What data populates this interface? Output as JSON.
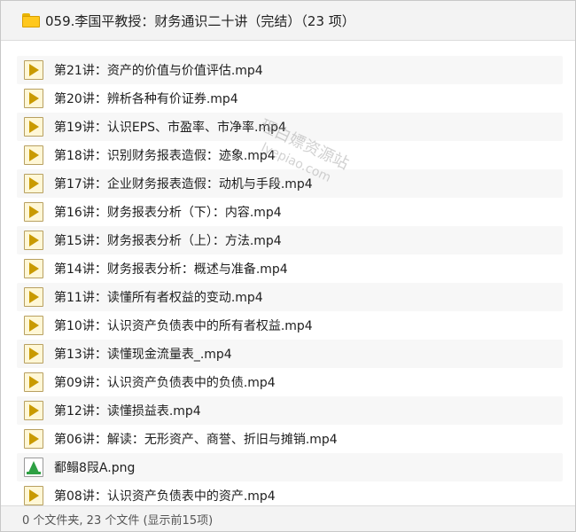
{
  "header": {
    "title": "059.李国平教授：财务通识二十讲（完结）（23 项）",
    "folder_icon": "folder-icon"
  },
  "files": [
    {
      "name": "第21讲：资产的价值与价值评估.mp4",
      "type": "mp4"
    },
    {
      "name": "第20讲：辨析各种有价证券.mp4",
      "type": "mp4"
    },
    {
      "name": "第19讲：认识EPS、市盈率、市净率.mp4",
      "type": "mp4"
    },
    {
      "name": "第18讲：识别财务报表造假：迹象.mp4",
      "type": "mp4"
    },
    {
      "name": "第17讲：企业财务报表造假：动机与手段.mp4",
      "type": "mp4"
    },
    {
      "name": "第16讲：财务报表分析（下）：内容.mp4",
      "type": "mp4"
    },
    {
      "name": "第15讲：财务报表分析（上）：方法.mp4",
      "type": "mp4"
    },
    {
      "name": "第14讲：财务报表分析：概述与准备.mp4",
      "type": "mp4"
    },
    {
      "name": "第11讲：读懂所有者权益的变动.mp4",
      "type": "mp4"
    },
    {
      "name": "第10讲：认识资产负债表中的所有者权益.mp4",
      "type": "mp4"
    },
    {
      "name": "第13讲：读懂现金流量表_.mp4",
      "type": "mp4"
    },
    {
      "name": "第09讲：认识资产负债表中的负债.mp4",
      "type": "mp4"
    },
    {
      "name": "第12讲：读懂损益表.mp4",
      "type": "mp4"
    },
    {
      "name": "第06讲：解读：无形资产、商誉、折旧与摊销.mp4",
      "type": "mp4"
    },
    {
      "name": "鄱鳎8叚A.png",
      "type": "png"
    },
    {
      "name": "第08讲：认识资产负债表中的资产.mp4",
      "type": "mp4"
    }
  ],
  "watermark": {
    "line1": "理白嫖资源站",
    "line2": "lyepiao.com"
  },
  "footer": {
    "status": "0 个文件夹, 23 个文件 (显示前15项)"
  },
  "colors": {
    "header_bg": "#f3f3f3",
    "row_alt_bg": "#f7f7f7",
    "mp4_icon": "#c99a00",
    "png_icon": "#2ea043",
    "folder": "#ffc81e"
  }
}
